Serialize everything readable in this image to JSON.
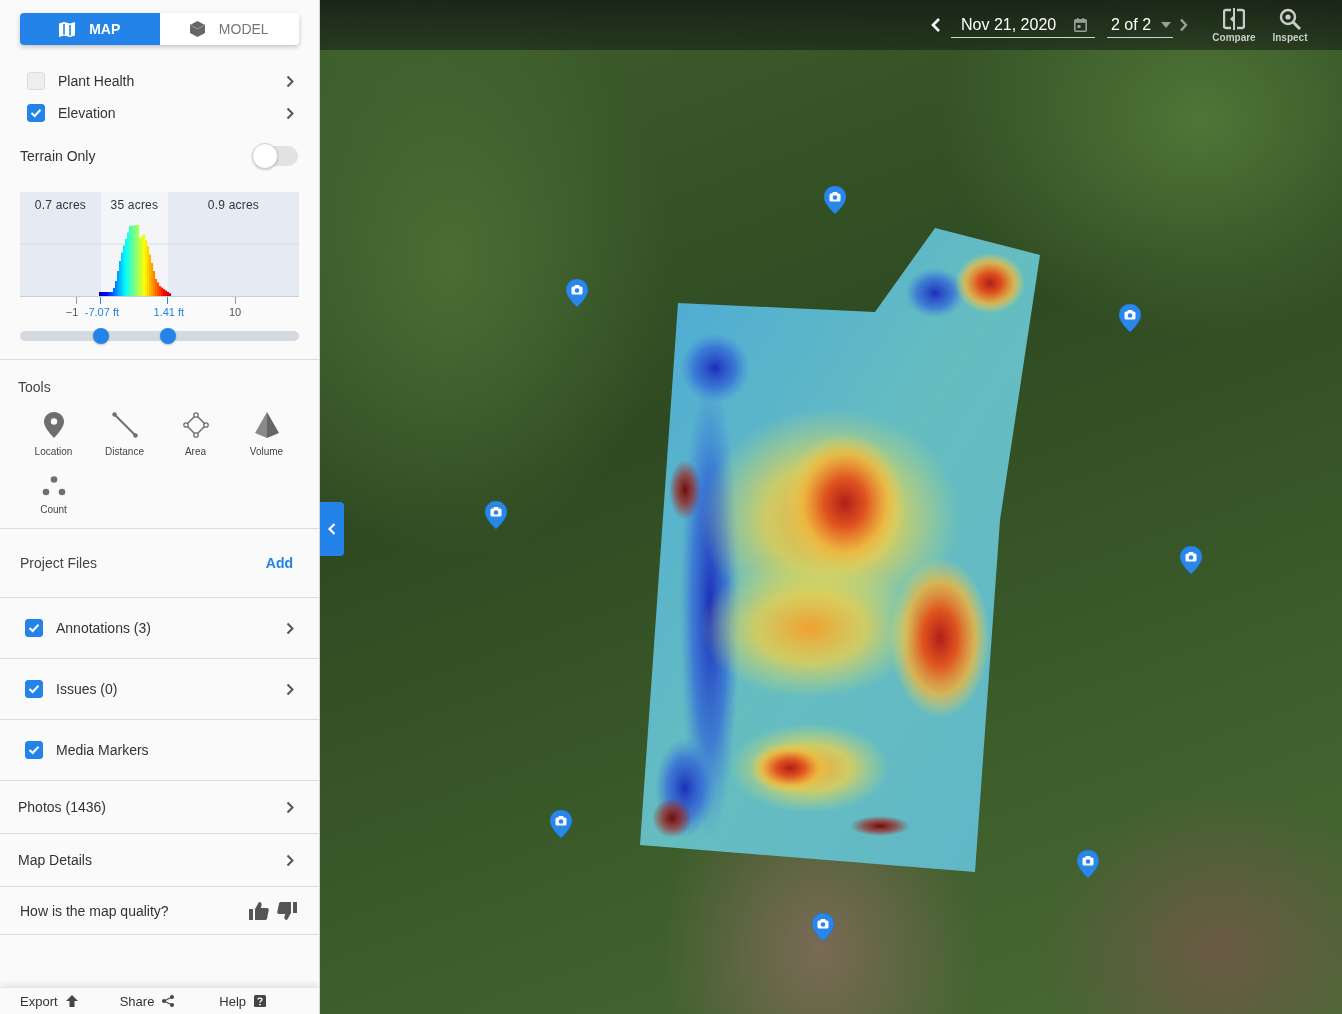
{
  "view_switch": [
    {
      "label": "MAP",
      "kind": "map",
      "selected": true
    },
    {
      "label": "MODEL",
      "kind": "model",
      "selected": false
    }
  ],
  "layers": [
    {
      "label": "Plant Health",
      "checked": false
    },
    {
      "label": "Elevation",
      "checked": true
    }
  ],
  "terrain_only": {
    "label": "Terrain Only",
    "on": false
  },
  "elevation_histogram": {
    "regions": [
      "0.7 acres",
      "35 acres",
      "0.9 acres"
    ],
    "axis_labels": [
      "−1",
      "10"
    ],
    "range_slider": {
      "thumbs": [
        {
          "level": 0.29,
          "reading": "-7.07 ft"
        },
        {
          "level": 0.53,
          "reading": "1.41 ft"
        }
      ]
    }
  },
  "tools": {
    "title": "Tools",
    "items": [
      {
        "label": "Location",
        "kind": "location"
      },
      {
        "label": "Distance",
        "kind": "distance"
      },
      {
        "label": "Area",
        "kind": "area"
      },
      {
        "label": "Volume",
        "kind": "volume"
      },
      {
        "label": "Count",
        "kind": "count"
      }
    ]
  },
  "project_files": {
    "title": "Project Files",
    "action": "Add",
    "items": [
      {
        "label": "Annotations (3)",
        "checked": true,
        "expandable": true
      },
      {
        "label": "Issues (0)",
        "checked": true,
        "expandable": true
      },
      {
        "label": "Media Markers",
        "checked": true,
        "expandable": false
      }
    ]
  },
  "menu_rows": [
    {
      "label": "Photos (1436)"
    },
    {
      "label": "Map Details"
    }
  ],
  "feedback": {
    "question": "How is the map quality?"
  },
  "footer": [
    {
      "label": "Export",
      "kind": "export"
    },
    {
      "label": "Share",
      "kind": "share"
    },
    {
      "label": "Help",
      "kind": "help"
    }
  ],
  "top_bar": {
    "date": "Nov 21, 2020",
    "version": "2 of 2",
    "actions": [
      {
        "label": "Compare",
        "kind": "compare"
      },
      {
        "label": "Inspect",
        "kind": "inspect"
      }
    ]
  }
}
